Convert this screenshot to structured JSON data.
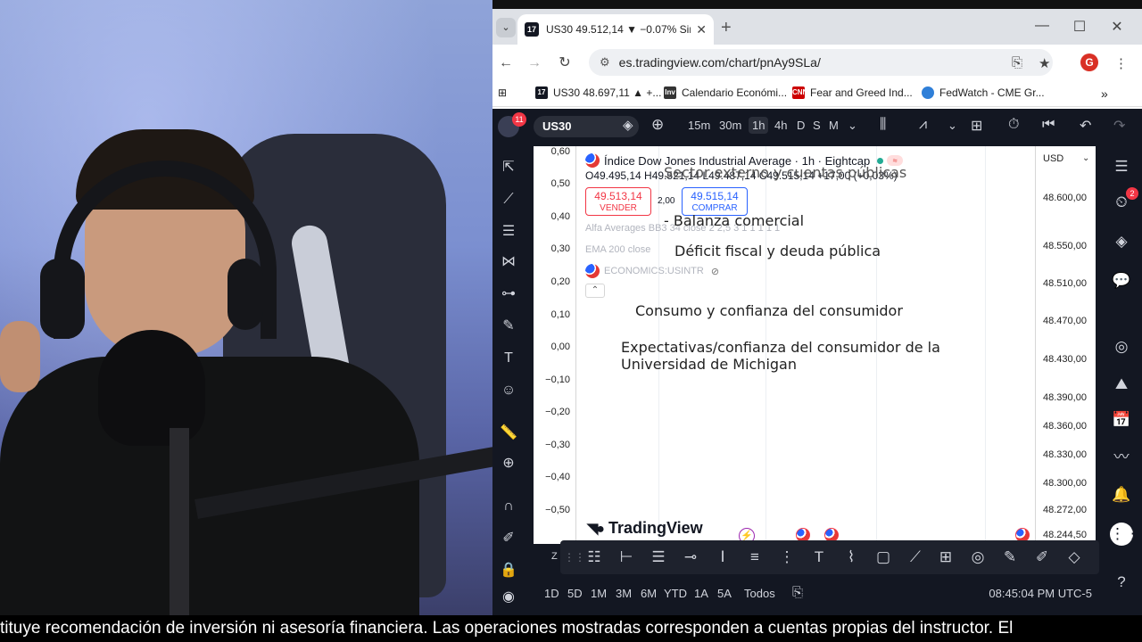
{
  "browser": {
    "tab_title": "US30 49.512,14 ▼ −0.07% Sin n",
    "tab_favicon": "17",
    "url": "es.tradingview.com/chart/pnAy9SLa/",
    "profile_initial": "G",
    "bookmarks": [
      {
        "label": "US30 48.697,11 ▲ +...",
        "icon": "17",
        "color": "#131722"
      },
      {
        "label": "Calendario Económi...",
        "icon": "Inv",
        "color": "#333333"
      },
      {
        "label": "Fear and Greed Ind...",
        "icon": "CNN",
        "color": "#cc0000"
      },
      {
        "label": "FedWatch - CME Gr...",
        "icon": "",
        "color": "#2f7fd8"
      }
    ]
  },
  "tv": {
    "notif_count": "11",
    "symbol": "US30",
    "timeframes": [
      "15m",
      "30m",
      "1h",
      "4h",
      "D",
      "S",
      "M"
    ],
    "active_timeframe": "1h",
    "right_badge": "2",
    "chart": {
      "title": "Índice Dow Jones Industrial Average · 1h · Eightcap",
      "ohlc": "O49.495,14  H49.521,14  L49.487,14  C49.515,14  +17,00 (+0,03%)",
      "sell_price": "49.513,14",
      "sell_label": "VENDER",
      "buy_price": "49.515,14",
      "buy_label": "COMPRAR",
      "spread": "2,00",
      "indicators": [
        "Alfa Averages BB3 34 close 2 2,5 3 1 1 1 1 1",
        "EMA 200 close",
        "ECONOMICS:USINTR"
      ],
      "currency": "USD",
      "left_ticks": [
        "0,60",
        "0,50",
        "0,40",
        "0,30",
        "0,20",
        "0,10",
        "0,00",
        "−0,10",
        "−0,20",
        "−0,30",
        "−0,40",
        "−0,50"
      ],
      "price_ticks": [
        "48.600,00",
        "48.550,00",
        "48.510,00",
        "48.470,00",
        "48.430,00",
        "48.390,00",
        "48.360,00",
        "48.330,00",
        "48.300,00",
        "48.272,00",
        "48.244,50"
      ],
      "logo_text": "TradingView",
      "zoom_label": "Z"
    },
    "overlay": {
      "line1": "Sector externo y cuentas públicas",
      "line2": "- Balanza comercial",
      "line3": "Déficit fiscal y deuda pública",
      "line4": "Consumo y confianza del consumidor",
      "line5a": "Expectativas/confianza del consumidor de la",
      "line5b": "Universidad de Michigan"
    },
    "ranges": [
      "1D",
      "5D",
      "1M",
      "3M",
      "6M",
      "YTD",
      "1A",
      "5A",
      "Todos"
    ],
    "time": "08:45:04 PM UTC-5"
  },
  "subtitle": "tituye recomendación de inversión ni asesoría financiera. Las operaciones mostradas corresponden a cuentas propias del instructor. El"
}
